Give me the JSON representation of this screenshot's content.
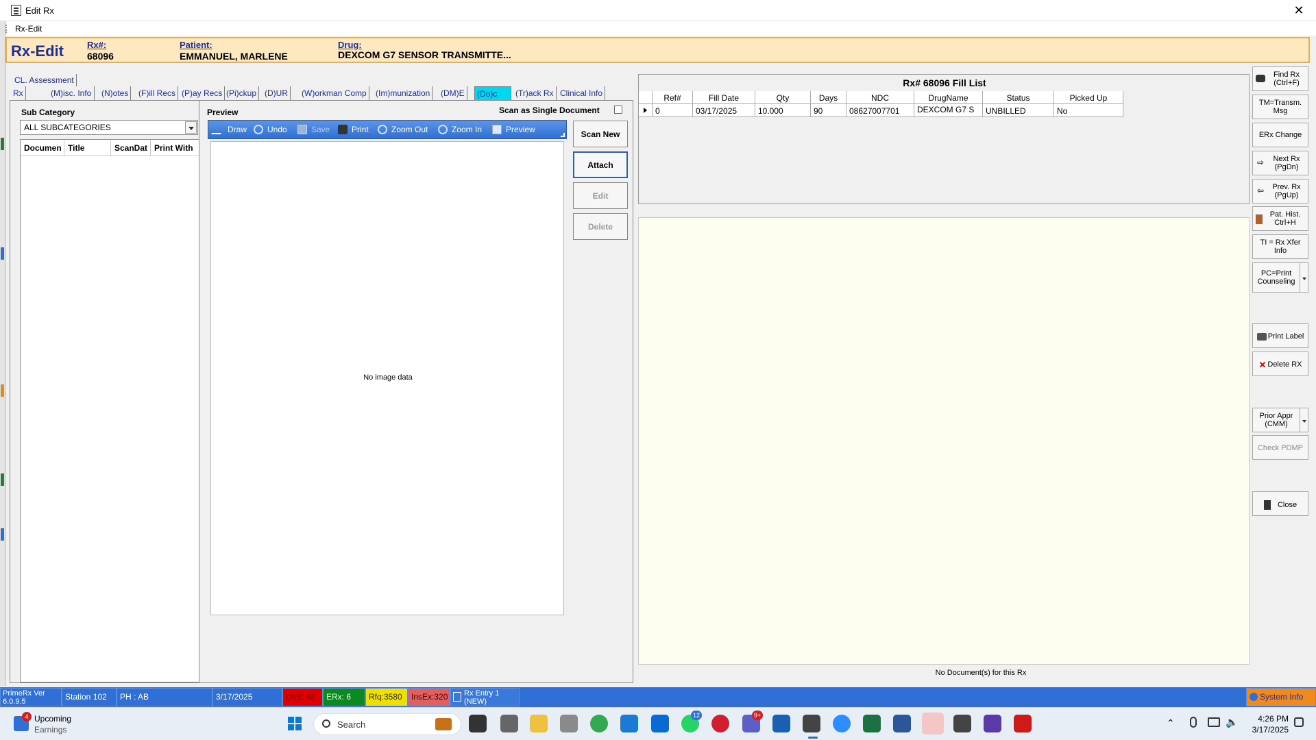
{
  "window": {
    "title": "Edit Rx",
    "menu_item": "Rx-Edit"
  },
  "header": {
    "title": "Rx-Edit",
    "rx_label": "Rx#:",
    "rx_value": "68096",
    "patient_label": "Patient:",
    "patient_value": "EMMANUEL, MARLENE",
    "drug_label": "Drug:",
    "drug_value": "DEXCOM G7 SENSOR TRANSMITTE..."
  },
  "tabs": {
    "row1": [
      "CL. Assessment"
    ],
    "row2": [
      "Rx",
      "(M)isc. Info",
      "(N)otes",
      "(F)ill Recs",
      "(P)ay Recs",
      "(Pi)ckup",
      "(D)UR",
      "(W)orkman Comp",
      "(Im)munization",
      "(DM)E",
      "(Do)c",
      "(Tr)ack Rx",
      "Clinical Info"
    ],
    "active": "(Do)c"
  },
  "doc": {
    "subcat_label": "Sub Category",
    "subcat_value": "ALL SUBCATEGORIES",
    "grid_headers": [
      "Documen",
      "Title",
      "ScanDat",
      "Print With"
    ],
    "preview_label": "Preview",
    "scan_single_label": "Scan as Single Document",
    "toolbar": [
      "Draw",
      "Undo",
      "Save",
      "Print",
      "Zoom Out",
      "Zoom In",
      "Preview"
    ],
    "no_image": "No image data",
    "buttons": {
      "scan_new": "Scan New",
      "attach": "Attach",
      "edit": "Edit",
      "delete": "Delete"
    }
  },
  "fill_list": {
    "title": "Rx# 68096 Fill List",
    "headers": [
      "Ref#",
      "Fill Date",
      "Qty",
      "Days",
      "NDC",
      "DrugName",
      "Status",
      "Picked Up"
    ],
    "rows": [
      [
        "0",
        "03/17/2025",
        "10.000",
        "90",
        "08627007701",
        "DEXCOM G7 S",
        "UNBILLED",
        "No"
      ]
    ]
  },
  "doc_footer": "No Document(s) for this Rx",
  "right_buttons": {
    "find_rx": [
      "Find Rx",
      "(Ctrl+F)"
    ],
    "tm": [
      "TM=Transm.",
      "Msg"
    ],
    "erx_change": "ERx Change",
    "next_rx": [
      "Next Rx",
      "(PgDn)"
    ],
    "prev_rx": [
      "Prev. Rx",
      "(PgUp)"
    ],
    "pat_hist": [
      "Pat. Hist.",
      "Ctrl+H"
    ],
    "ti": [
      "TI = Rx Xfer",
      "Info"
    ],
    "pc": [
      "PC=Print",
      "Counseling"
    ],
    "print_label": "Print Label",
    "delete_rx": "Delete RX",
    "prior_appr": [
      "Prior Appr",
      "(CMM)"
    ],
    "check_pdmp": "Check PDMP",
    "close": "Close"
  },
  "status": {
    "version": [
      "PrimeRx Ver",
      "6.0.9.5"
    ],
    "station": "Station 102",
    "ph": "PH : AB",
    "date": "3/17/2025",
    "unb": "UnB: 68",
    "erx": "ERx: 6",
    "rfq": "Rfq:3580",
    "insex": "InsEx:320",
    "rx_entry": [
      "Rx Entry 1",
      "(NEW)"
    ],
    "system_info": "System Info"
  },
  "taskbar": {
    "weather_title": "Upcoming",
    "weather_sub": "Earnings",
    "weather_badge": "4",
    "search": "Search",
    "badge_whatsapp": "12",
    "badge_teams": "9+",
    "time": "4:26 PM",
    "date": "3/17/2025"
  },
  "colors": {
    "accent": "#2f6fd6",
    "header_bg": "#fde8c0",
    "active_tab": "#00d8f0",
    "unb": "#e00000",
    "erx": "#0a8a20",
    "rfq": "#f0e000",
    "insex": "#e06060",
    "system_info": "#f08a20"
  }
}
